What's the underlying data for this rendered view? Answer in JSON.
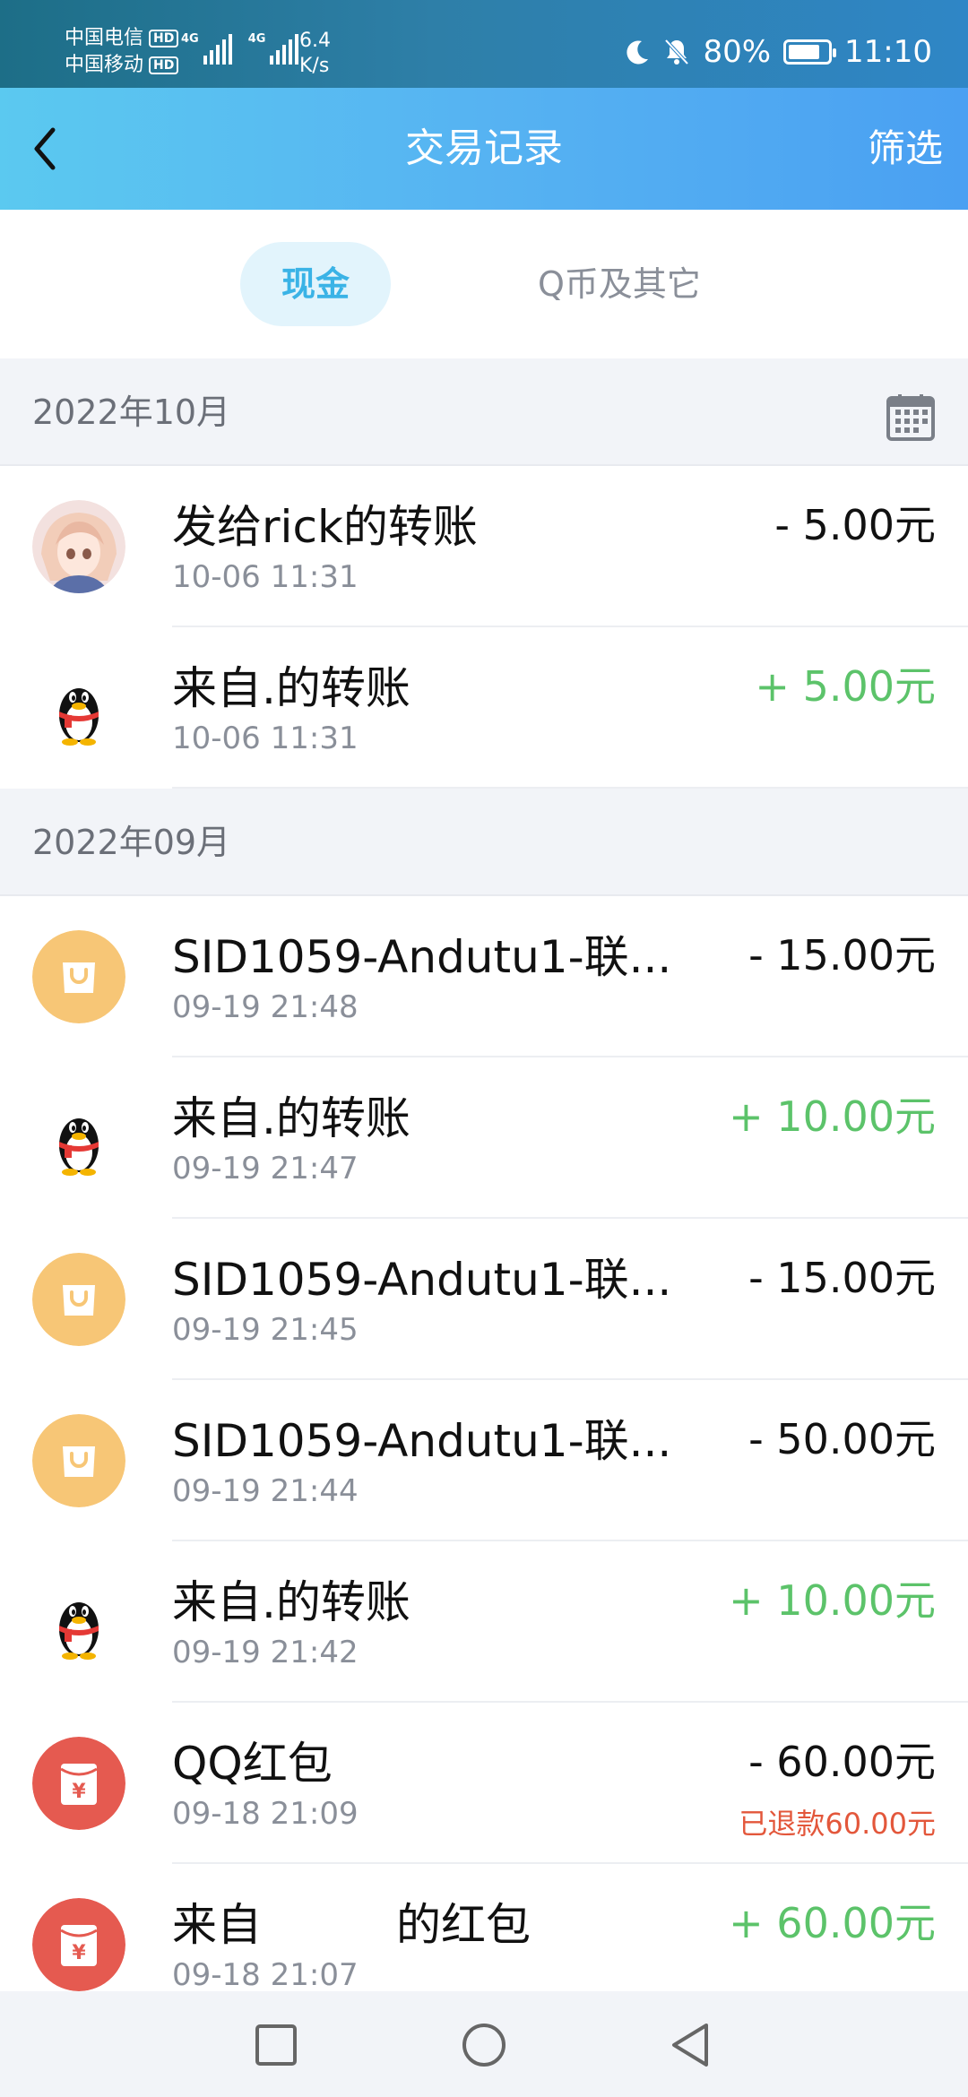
{
  "status_bar": {
    "carrier1": "中国电信",
    "carrier2": "中国移动",
    "hd": "HD",
    "net1": "4G",
    "net2": "4G",
    "speed_value": "6.4",
    "speed_unit": "K/s",
    "battery": "80%",
    "battery_level": 0.8,
    "time": "11:10",
    "icons": [
      "moon-icon",
      "mute-bell-icon",
      "battery-icon"
    ]
  },
  "header": {
    "title": "交易记录",
    "filter_label": "筛选"
  },
  "tabs": {
    "cash": "现金",
    "q_coin": "Q币及其它"
  },
  "colors": {
    "header_start": "#5bc9f0",
    "header_end": "#4aa0f2",
    "tab_active": "#3ab3e6",
    "income": "#5cc36a",
    "refund": "#e3573b",
    "shop_icon_bg": "#f7c676",
    "red_packet_bg": "#e55a50"
  },
  "sections": [
    {
      "month": "2022年10月",
      "items": [
        {
          "type": "photo",
          "title": "发给rick的转账",
          "time": "10-06 11:31",
          "amount": "- 5.00元",
          "sign": "minus"
        },
        {
          "type": "penguin",
          "title": "来自.的转账",
          "time": "10-06 11:31",
          "amount": "+ 5.00元",
          "sign": "plus"
        }
      ]
    },
    {
      "month": "2022年09月",
      "items": [
        {
          "type": "shop",
          "title": "SID1059-Andutu1-联...",
          "time": "09-19 21:48",
          "amount": "- 15.00元",
          "sign": "minus"
        },
        {
          "type": "penguin",
          "title": "来自.的转账",
          "time": "09-19 21:47",
          "amount": "+ 10.00元",
          "sign": "plus"
        },
        {
          "type": "shop",
          "title": "SID1059-Andutu1-联...",
          "time": "09-19 21:45",
          "amount": "- 15.00元",
          "sign": "minus"
        },
        {
          "type": "shop",
          "title": "SID1059-Andutu1-联...",
          "time": "09-19 21:44",
          "amount": "- 50.00元",
          "sign": "minus"
        },
        {
          "type": "penguin",
          "title": "来自.的转账",
          "time": "09-19 21:42",
          "amount": "+ 10.00元",
          "sign": "plus"
        },
        {
          "type": "redpacket",
          "title": "QQ红包",
          "time": "09-18 21:09",
          "amount": "- 60.00元",
          "sign": "minus",
          "note": "已退款60.00元"
        },
        {
          "type": "redpacket",
          "title": "来自　　　的红包",
          "time": "09-18 21:07",
          "amount": "+ 60.00元",
          "sign": "plus"
        }
      ]
    }
  ],
  "nav": [
    "recent-apps-button",
    "home-button",
    "back-nav-button"
  ]
}
